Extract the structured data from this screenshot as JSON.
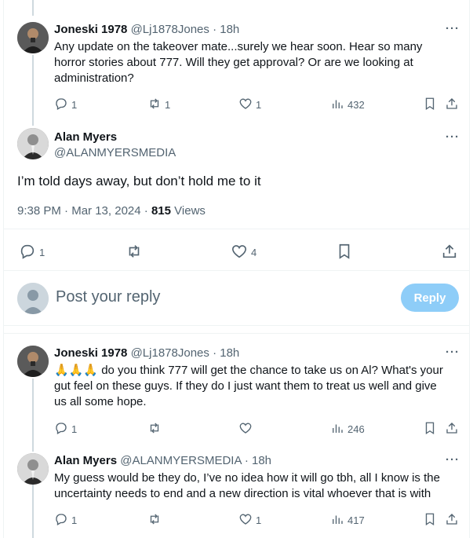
{
  "tweets": [
    {
      "name": "Joneski 1978",
      "handle": "@Lj1878Jones",
      "time": "18h",
      "text_lines": [
        "Any update on the takeover mate...surely we hear soon. Hear so many",
        "horror stories about 777. Will they get approval? Or are we looking at",
        "administration?"
      ],
      "replies": "1",
      "retweets": "1",
      "likes": "1",
      "views": "432"
    }
  ],
  "main": {
    "name": "Alan Myers",
    "handle": "@ALANMYERSMEDIA",
    "text": "I’m told days away, but don’t hold me to it",
    "time": "9:38 PM",
    "date": "Mar 13, 2024",
    "views_count": "815",
    "views_label": "Views",
    "replies": "1",
    "likes": "4"
  },
  "composer": {
    "placeholder": "Post your reply",
    "button": "Reply"
  },
  "replies": [
    {
      "name": "Joneski 1978",
      "handle": "@Lj1878Jones",
      "time": "18h",
      "emoji": "🙏🙏🙏",
      "text_lines": [
        "do you think 777 will get the chance to take us on Al? What's your",
        "gut feel on these guys. If they do I just want them to treat us well and give",
        "us all some hope."
      ],
      "replies": "1",
      "views": "246"
    },
    {
      "name": "Alan Myers",
      "handle": "@ALANMYERSMEDIA",
      "time": "18h",
      "text_lines": [
        "My guess would be they do, I’ve no idea how it will go tbh, all I know is the",
        "uncertainty needs to end and a new direction is vital whoever that is with"
      ],
      "replies": "1",
      "likes": "1",
      "views": "417"
    }
  ],
  "separator": "·",
  "more": "···",
  "colors": {
    "accent": "#1d9bf0",
    "reply_button": "#8ecdf8",
    "muted": "#536471",
    "text": "#0f1419"
  }
}
